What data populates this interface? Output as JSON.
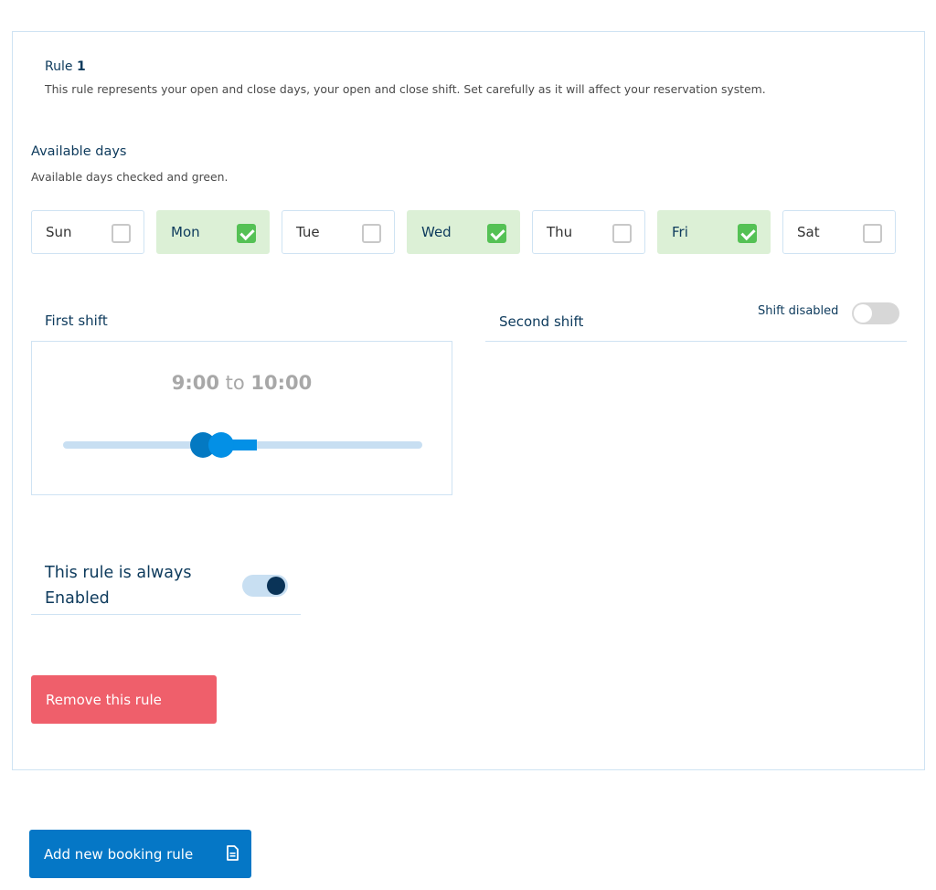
{
  "rule": {
    "title_prefix": "Rule",
    "number": "1",
    "description": "This rule represents your open and close days, your open and close shift. Set carefully as it will affect your reservation system."
  },
  "available_days": {
    "title": "Available days",
    "subtitle": "Available days checked and green.",
    "days": [
      {
        "label": "Sun",
        "checked": false
      },
      {
        "label": "Mon",
        "checked": true
      },
      {
        "label": "Tue",
        "checked": false
      },
      {
        "label": "Wed",
        "checked": true
      },
      {
        "label": "Thu",
        "checked": false
      },
      {
        "label": "Fri",
        "checked": true
      },
      {
        "label": "Sat",
        "checked": false
      }
    ]
  },
  "first_shift": {
    "label": "First shift",
    "start": "9:00",
    "separator": "to",
    "end": "10:00",
    "slider": {
      "start_fraction": 0.39,
      "end_fraction": 0.54
    }
  },
  "second_shift": {
    "label": "Second shift",
    "status_label": "Shift disabled",
    "enabled": false
  },
  "always_enabled": {
    "label": "This rule is always Enabled",
    "enabled": true
  },
  "buttons": {
    "remove": "Remove this rule",
    "add": "Add new booking rule"
  },
  "colors": {
    "accent": "#0577c6",
    "danger": "#ef5f6b",
    "checked_green": "#55c155",
    "checked_bg": "#dcf0d6"
  }
}
